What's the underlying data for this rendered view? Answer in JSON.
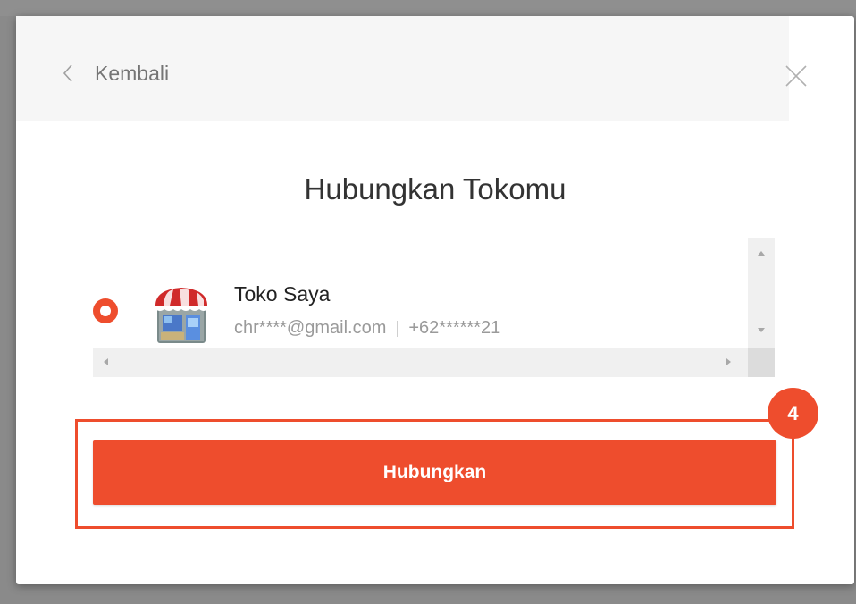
{
  "modal": {
    "back_label": "Kembali",
    "title": "Hubungkan Tokomu",
    "shop": {
      "name": "Toko Saya",
      "email": "chr****@gmail.com",
      "phone": "+62******21",
      "selected": true
    },
    "primary_button_label": "Hubungkan"
  },
  "annotation": {
    "step_number": "4"
  },
  "colors": {
    "accent": "#ee4d2d",
    "header_bg": "#f6f6f6",
    "backdrop": "#8a8a8a"
  },
  "icons": {
    "back": "chevron-left-icon",
    "close": "close-icon",
    "shop": "shop-storefront-icon"
  }
}
